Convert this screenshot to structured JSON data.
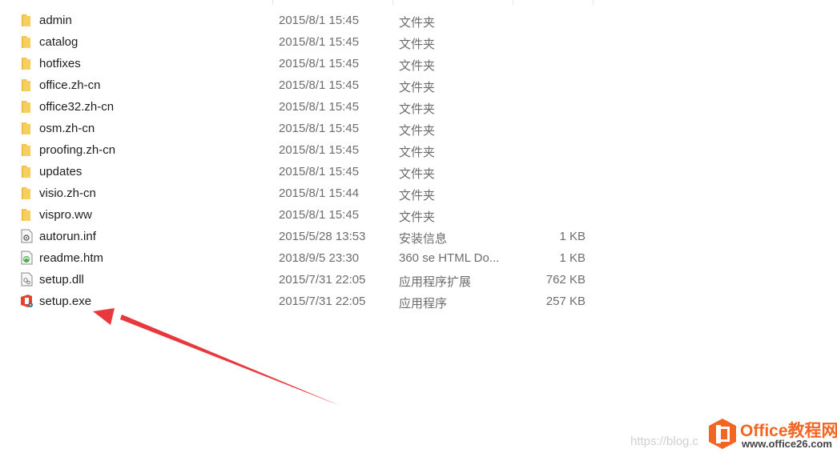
{
  "files": [
    {
      "name": "admin",
      "date": "2015/8/1 15:45",
      "type": "文件夹",
      "size": "",
      "icon": "folder-icon"
    },
    {
      "name": "catalog",
      "date": "2015/8/1 15:45",
      "type": "文件夹",
      "size": "",
      "icon": "folder-icon"
    },
    {
      "name": "hotfixes",
      "date": "2015/8/1 15:45",
      "type": "文件夹",
      "size": "",
      "icon": "folder-icon"
    },
    {
      "name": "office.zh-cn",
      "date": "2015/8/1 15:45",
      "type": "文件夹",
      "size": "",
      "icon": "folder-icon"
    },
    {
      "name": "office32.zh-cn",
      "date": "2015/8/1 15:45",
      "type": "文件夹",
      "size": "",
      "icon": "folder-icon"
    },
    {
      "name": "osm.zh-cn",
      "date": "2015/8/1 15:45",
      "type": "文件夹",
      "size": "",
      "icon": "folder-icon"
    },
    {
      "name": "proofing.zh-cn",
      "date": "2015/8/1 15:45",
      "type": "文件夹",
      "size": "",
      "icon": "folder-icon"
    },
    {
      "name": "updates",
      "date": "2015/8/1 15:45",
      "type": "文件夹",
      "size": "",
      "icon": "folder-icon"
    },
    {
      "name": "visio.zh-cn",
      "date": "2015/8/1 15:44",
      "type": "文件夹",
      "size": "",
      "icon": "folder-icon"
    },
    {
      "name": "vispro.ww",
      "date": "2015/8/1 15:45",
      "type": "文件夹",
      "size": "",
      "icon": "folder-icon"
    },
    {
      "name": "autorun.inf",
      "date": "2015/5/28 13:53",
      "type": "安装信息",
      "size": "1 KB",
      "icon": "settings-file-icon"
    },
    {
      "name": "readme.htm",
      "date": "2018/9/5 23:30",
      "type": "360 se HTML Do...",
      "size": "1 KB",
      "icon": "html-file-icon"
    },
    {
      "name": "setup.dll",
      "date": "2015/7/31 22:05",
      "type": "应用程序扩展",
      "size": "762 KB",
      "icon": "dll-file-icon"
    },
    {
      "name": "setup.exe",
      "date": "2015/7/31 22:05",
      "type": "应用程序",
      "size": "257 KB",
      "icon": "office-setup-icon"
    }
  ],
  "annotation": {
    "color": "#e8383d",
    "points_to": "setup.exe"
  },
  "watermark": {
    "blog_text": "https://blog.c",
    "brand_title": "Office教程网",
    "brand_url": "www.office26.com",
    "brand_color": "#f26522"
  },
  "colors": {
    "folder": "#f4c24d",
    "name_text": "#1e1e1e",
    "detail_text": "#6d6d6d"
  }
}
